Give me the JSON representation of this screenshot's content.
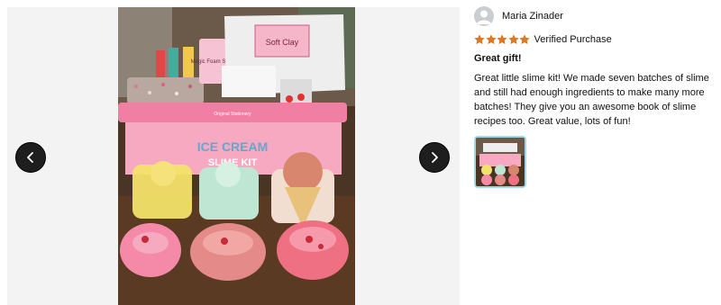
{
  "gallery": {
    "prev_icon": "chevron-left-icon",
    "next_icon": "chevron-right-icon",
    "photo_labels": {
      "tub_line1": "ICE CREAM",
      "tub_line2": "SLIME KIT",
      "clay_label": "Soft Clay",
      "bottle_label": "Magic Foam Soap",
      "tub_top_label": "Original Stationery"
    }
  },
  "review": {
    "reviewer_name": "Maria Zinader",
    "rating": 5,
    "rating_max": 5,
    "verified_label": "Verified Purchase",
    "title": "Great gift!",
    "body": "Great little slime kit! We made seven batches of slime and still had enough ingredients to make many more batches! They give you an awesome book of slime recipes too. Great value, lots of fun!",
    "colors": {
      "star": "#de7921",
      "thumb_border": "#9fd7ef"
    }
  }
}
